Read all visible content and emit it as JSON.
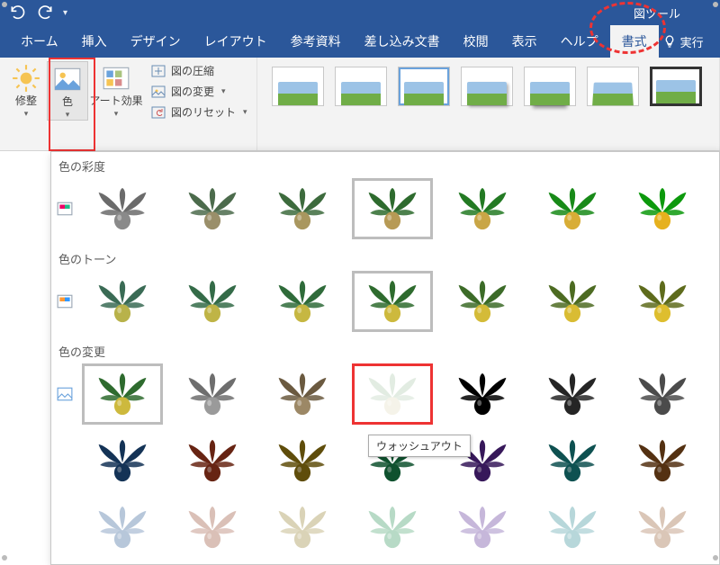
{
  "titlebar": {
    "contextual_label": "図ツール"
  },
  "tabs": {
    "items": [
      {
        "label": "ホーム"
      },
      {
        "label": "挿入"
      },
      {
        "label": "デザイン"
      },
      {
        "label": "レイアウト"
      },
      {
        "label": "参考資料"
      },
      {
        "label": "差し込み文書"
      },
      {
        "label": "校閲"
      },
      {
        "label": "表示"
      },
      {
        "label": "ヘルプ"
      },
      {
        "label": "書式",
        "active": true
      }
    ],
    "tell_me": "実行"
  },
  "ribbon": {
    "adjust": {
      "corrections": "修整",
      "color": "色",
      "artistic": "アート効果",
      "compress": "図の圧縮",
      "change": "図の変更",
      "reset": "図のリセット"
    }
  },
  "gallery": {
    "sections": {
      "saturation": "色の彩度",
      "tone": "色のトーン",
      "recolor": "色の変更"
    },
    "tooltip": "ウォッシュアウト"
  }
}
